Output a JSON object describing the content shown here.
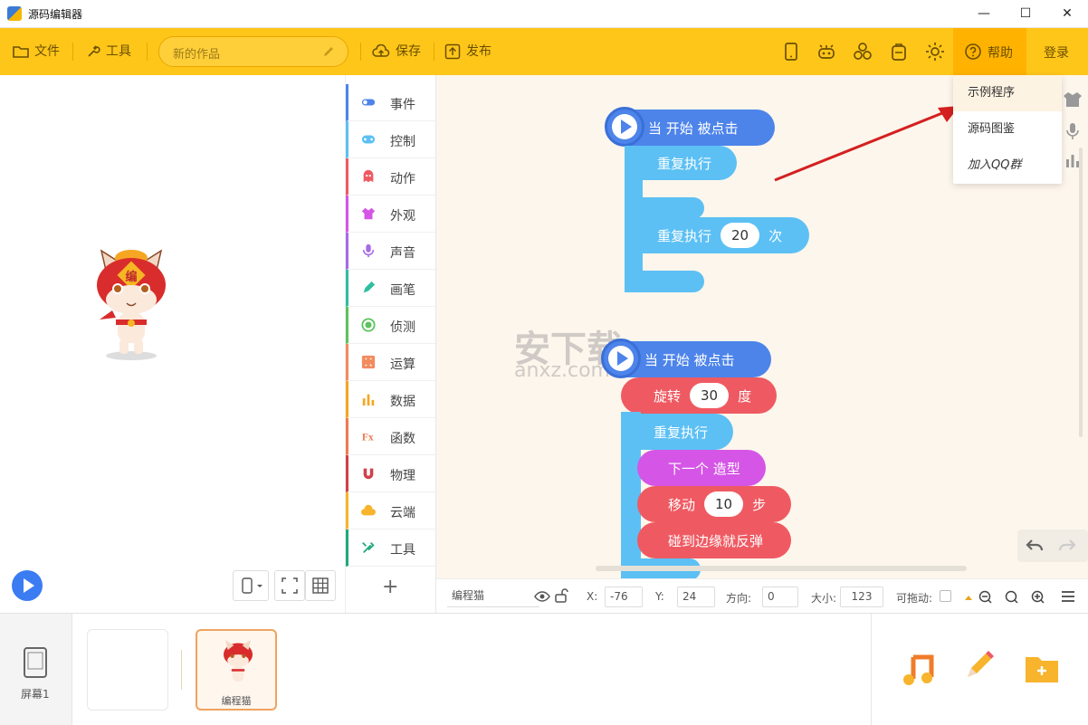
{
  "window": {
    "title": "源码编辑器"
  },
  "toolbar": {
    "file_label": "文件",
    "tools_label": "工具",
    "project_name": "新的作品",
    "save_label": "保存",
    "publish_label": "发布",
    "help_label": "帮助",
    "login_label": "登录"
  },
  "help_menu": {
    "items": [
      "示例程序",
      "源码图鉴",
      "加入QQ群"
    ]
  },
  "categories": [
    {
      "label": "事件",
      "color": "#4d84ea"
    },
    {
      "label": "控制",
      "color": "#5cc0f4"
    },
    {
      "label": "动作",
      "color": "#ef5a62"
    },
    {
      "label": "外观",
      "color": "#d555e6"
    },
    {
      "label": "声音",
      "color": "#a56be8"
    },
    {
      "label": "画笔",
      "color": "#2ebfa0"
    },
    {
      "label": "侦测",
      "color": "#5bc35b"
    },
    {
      "label": "运算",
      "color": "#f28b5f"
    },
    {
      "label": "数据",
      "color": "#f5a623"
    },
    {
      "label": "函数",
      "color": "#ee7a52"
    },
    {
      "label": "物理",
      "color": "#d0404a"
    },
    {
      "label": "云端",
      "color": "#f7b42c"
    },
    {
      "label": "工具",
      "color": "#1fa87d"
    }
  ],
  "blocks": {
    "when_start_1": "当 开始 被点击",
    "repeat_forever_1": "重复执行",
    "repeat_n_label": "重复执行",
    "repeat_n_value": "20",
    "repeat_n_unit": "次",
    "when_start_2": "当 开始 被点击",
    "rotate_label": "旋转",
    "rotate_value": "30",
    "rotate_unit": "度",
    "repeat_forever_2": "重复执行",
    "next_costume": "下一个 造型",
    "move_label": "移动",
    "move_value": "10",
    "move_unit": "步",
    "bounce": "碰到边缘就反弹"
  },
  "watermark": {
    "text": "安下载",
    "sub": "anxz.com"
  },
  "property_bar": {
    "sprite_name": "编程猫",
    "x_label": "X:",
    "x_value": "-76",
    "y_label": "Y:",
    "y_value": "24",
    "dir_label": "方向:",
    "dir_value": "0",
    "size_label": "大小:",
    "size_value": "123",
    "drag_label": "可拖动:"
  },
  "bottom": {
    "screen_label": "屏幕1",
    "sprite_label": "编程猫"
  }
}
